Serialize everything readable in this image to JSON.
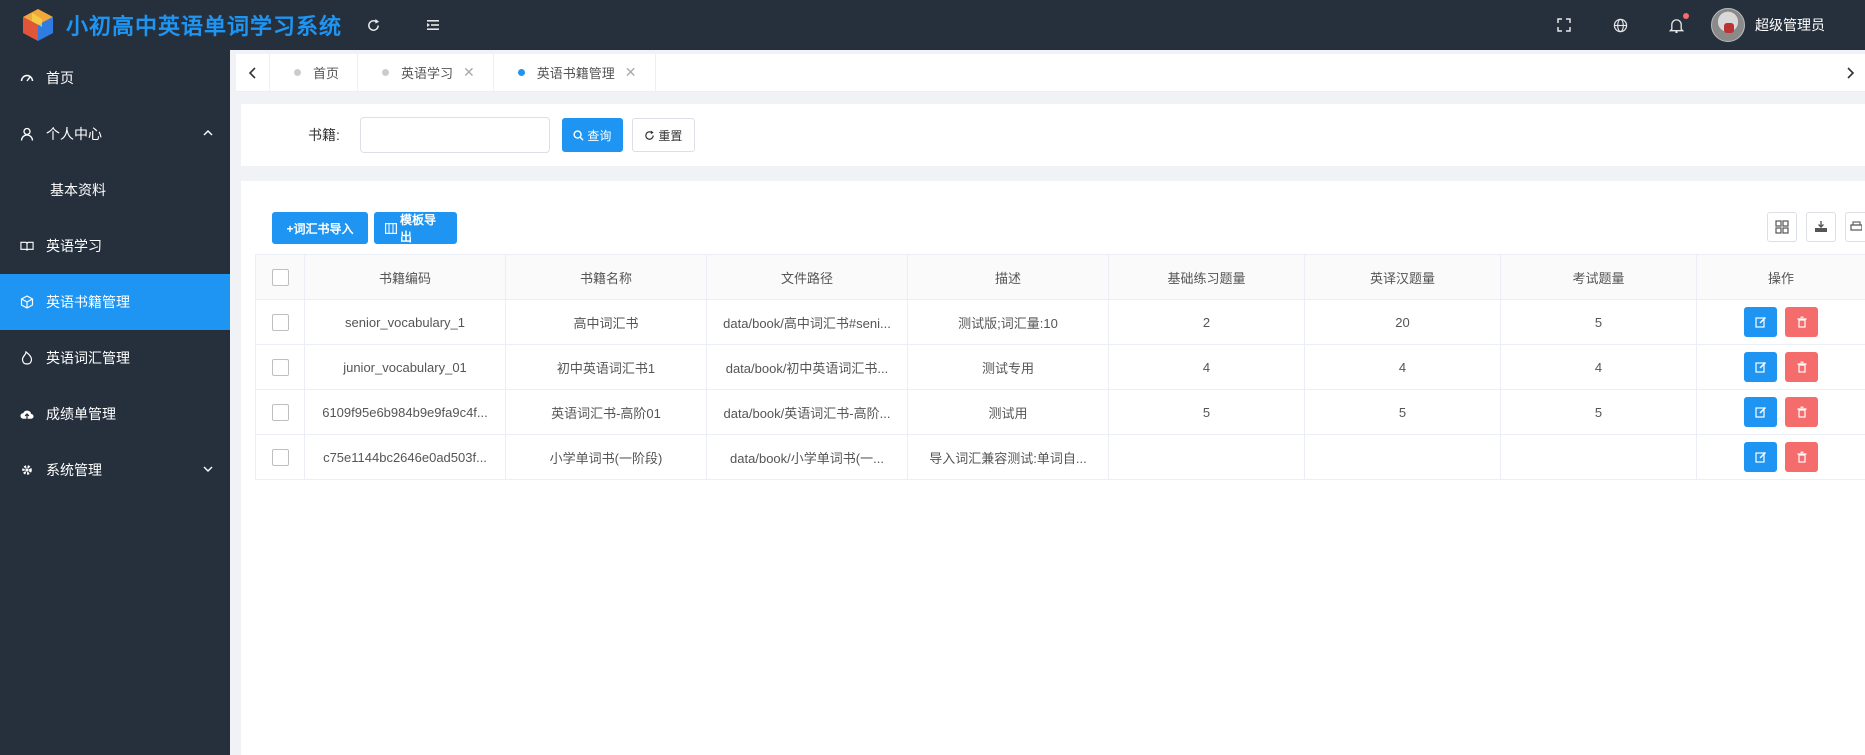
{
  "header": {
    "title": "小初高中英语单词学习系统",
    "user_name": "超级管理员"
  },
  "sidebar": {
    "items": [
      {
        "label": "首页",
        "icon": "dashboard-icon"
      },
      {
        "label": "个人中心",
        "icon": "user-icon",
        "expanded": true
      },
      {
        "label": "基本资料",
        "sub": true
      },
      {
        "label": "英语学习",
        "icon": "book-icon"
      },
      {
        "label": "英语书籍管理",
        "icon": "cube-icon",
        "active": true
      },
      {
        "label": "英语词汇管理",
        "icon": "fire-icon"
      },
      {
        "label": "成绩单管理",
        "icon": "cloud-upload-icon"
      },
      {
        "label": "系统管理",
        "icon": "settings-icon",
        "expanded": false
      }
    ]
  },
  "tabs": [
    {
      "label": "首页",
      "closable": false,
      "active": false
    },
    {
      "label": "英语学习",
      "closable": true,
      "active": false
    },
    {
      "label": "英语书籍管理",
      "closable": true,
      "active": true
    }
  ],
  "search": {
    "label": "书籍:",
    "value": "",
    "placeholder": "",
    "query_label": "查询",
    "reset_label": "重置"
  },
  "toolbar": {
    "import_label": "+词汇书导入",
    "export_label": "模板导出"
  },
  "table": {
    "columns": [
      "书籍编码",
      "书籍名称",
      "文件路径",
      "描述",
      "基础练习题量",
      "英译汉题量",
      "考试题量",
      "操作"
    ],
    "rows": [
      [
        "senior_vocabulary_1",
        "高中词汇书",
        "data/book/高中词汇书#seni...",
        "测试版;词汇量:10",
        "2",
        "20",
        "5"
      ],
      [
        "junior_vocabulary_01",
        "初中英语词汇书1",
        "data/book/初中英语词汇书...",
        "测试专用",
        "4",
        "4",
        "4"
      ],
      [
        "6109f95e6b984b9e9fa9c4f...",
        "英语词汇书-高阶01",
        "data/book/英语词汇书-高阶...",
        "测试用",
        "5",
        "5",
        "5"
      ],
      [
        "c75e1144bc2646e0ad503f...",
        "小学单词书(一阶段)",
        "data/book/小学单词书(一...",
        "导入词汇兼容测试:单词自...",
        "",
        "",
        ""
      ]
    ]
  },
  "colors": {
    "accent": "#1e95f2",
    "danger": "#f56c6c",
    "sidebar_bg": "#26303d"
  }
}
